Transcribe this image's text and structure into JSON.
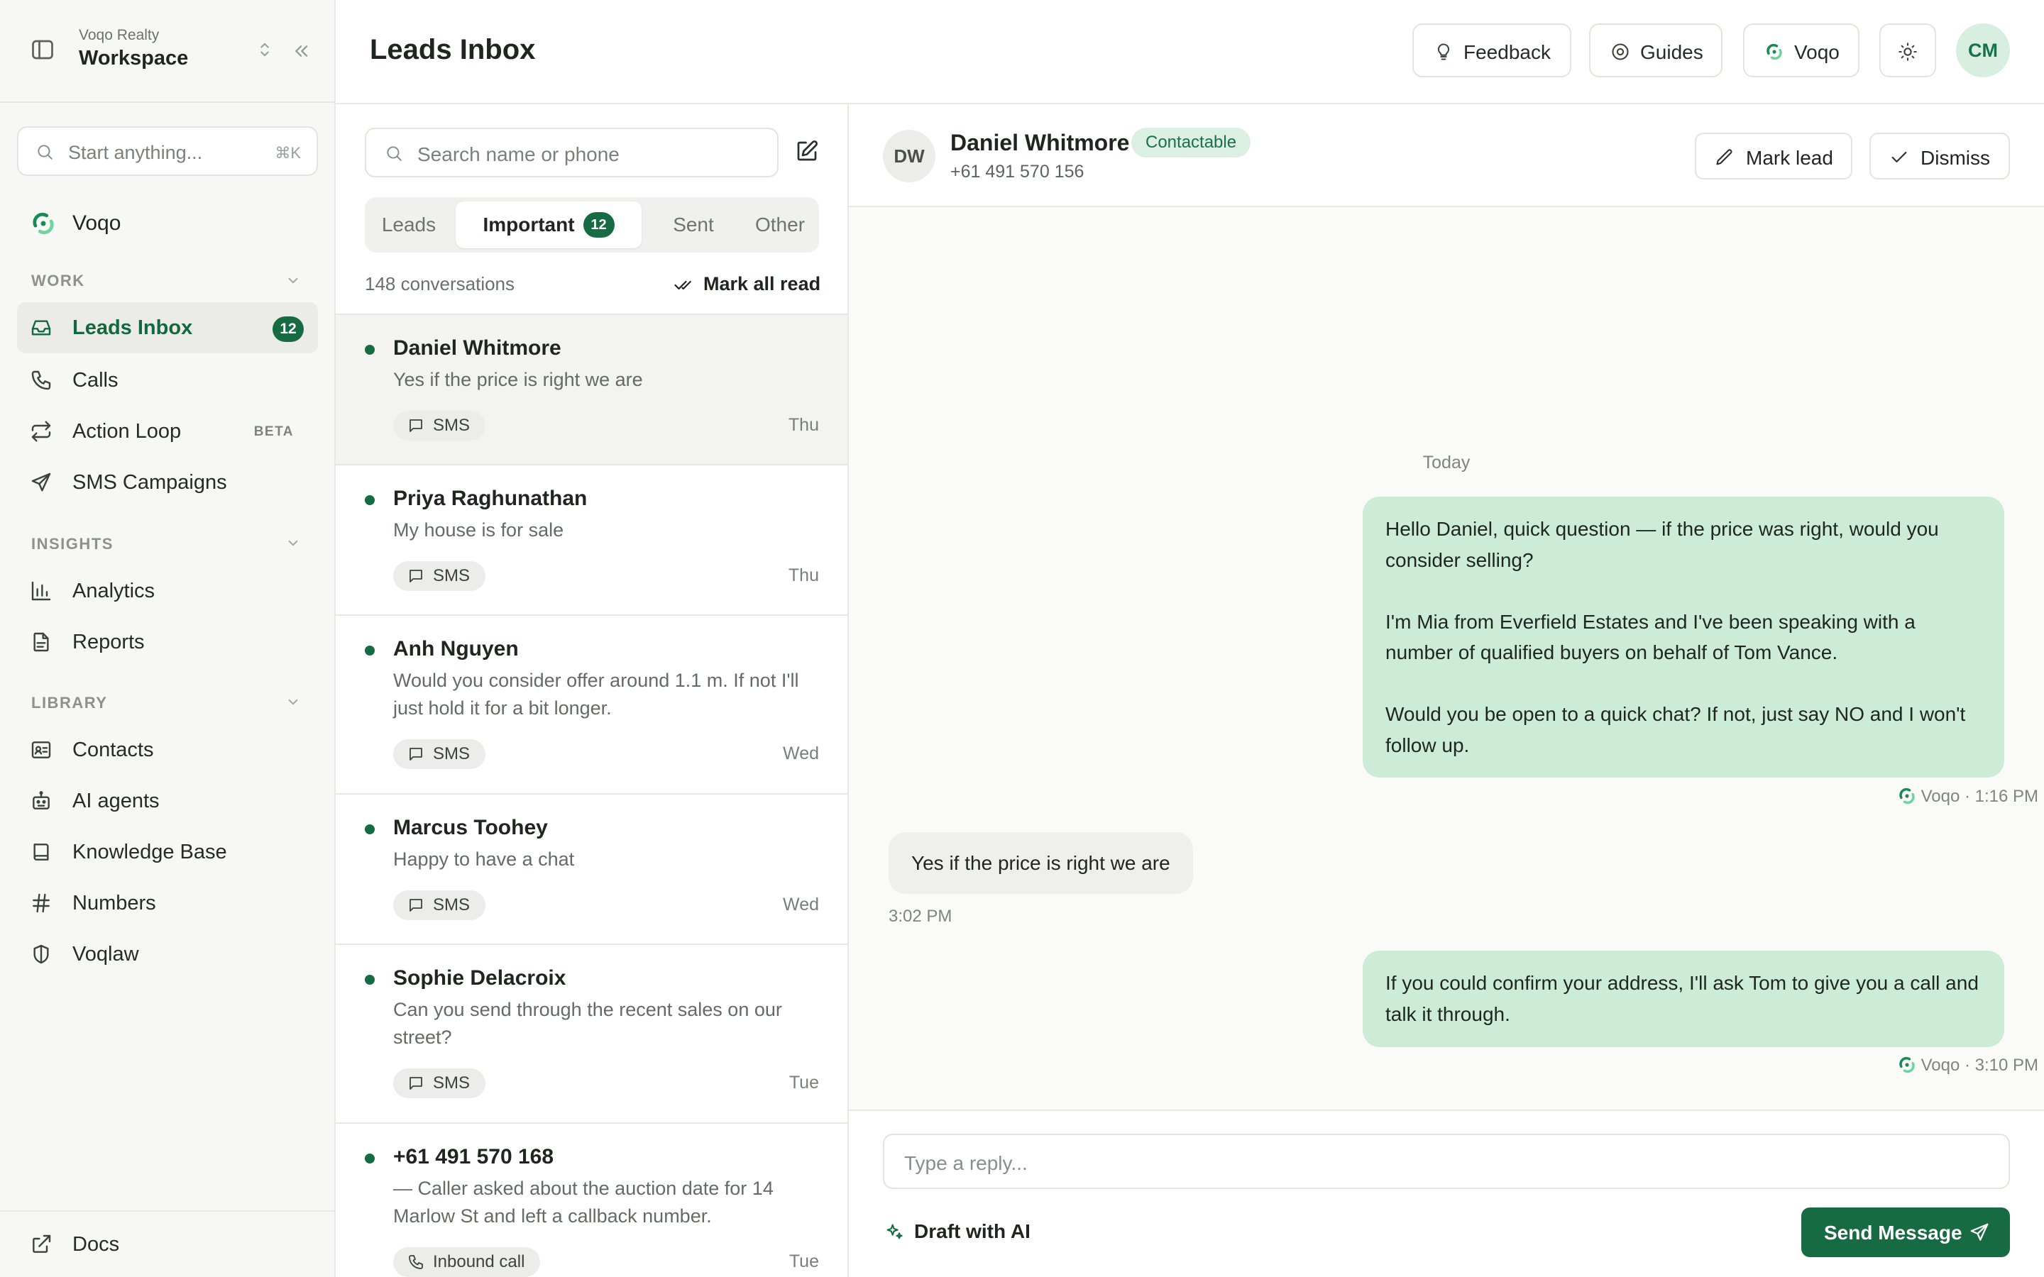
{
  "workspace": {
    "org": "Voqo Realty",
    "name": "Workspace"
  },
  "sidebar": {
    "search_placeholder": "Start anything...",
    "search_shortcut": "⌘K",
    "brand_label": "Voqo",
    "sections": {
      "work": "WORK",
      "insights": "INSIGHTS",
      "library": "LIBRARY"
    },
    "items": {
      "leads_inbox": {
        "label": "Leads Inbox",
        "badge": "12",
        "icon": "inbox-icon"
      },
      "calls": {
        "label": "Calls",
        "icon": "phone-icon"
      },
      "action_loop": {
        "label": "Action Loop",
        "tag": "BETA",
        "icon": "repeat-icon"
      },
      "sms_campaigns": {
        "label": "SMS Campaigns",
        "icon": "send-icon"
      },
      "analytics": {
        "label": "Analytics",
        "icon": "bar-chart-icon"
      },
      "reports": {
        "label": "Reports",
        "icon": "file-text-icon"
      },
      "contacts": {
        "label": "Contacts",
        "icon": "contact-card-icon"
      },
      "ai_agents": {
        "label": "AI agents",
        "icon": "robot-icon"
      },
      "knowledge_base": {
        "label": "Knowledge Base",
        "icon": "book-icon"
      },
      "numbers": {
        "label": "Numbers",
        "icon": "hash-icon"
      },
      "voqlaw": {
        "label": "Voqlaw",
        "icon": "shield-icon"
      }
    },
    "footer": {
      "docs": {
        "label": "Docs",
        "icon": "external-link-icon"
      }
    }
  },
  "header": {
    "title": "Leads Inbox",
    "feedback": "Feedback",
    "guides": "Guides",
    "voqo": "Voqo",
    "user_initials": "CM"
  },
  "list": {
    "search_placeholder": "Search name or phone",
    "tabs": {
      "leads": "Leads",
      "important": "Important",
      "important_count": "12",
      "sent": "Sent",
      "other": "Other"
    },
    "count_text": "148 conversations",
    "mark_all_read": "Mark all read",
    "conversations": [
      {
        "name": "Daniel Whitmore",
        "preview": "Yes if the price is right we are",
        "channel": "SMS",
        "time": "Thu"
      },
      {
        "name": "Priya Raghunathan",
        "preview": "My house is for sale",
        "channel": "SMS",
        "time": "Thu"
      },
      {
        "name": "Anh Nguyen",
        "preview": "Would you consider offer around 1.1 m. If not I'll just hold it for a bit longer.",
        "channel": "SMS",
        "time": "Wed"
      },
      {
        "name": "Marcus Toohey",
        "preview": "Happy to have a chat",
        "channel": "SMS",
        "time": "Wed"
      },
      {
        "name": "Sophie Delacroix",
        "preview": "Can you send through the recent sales on our street?",
        "channel": "SMS",
        "time": "Tue"
      },
      {
        "name": "+61 491 570 168",
        "preview": "— Caller asked about the auction date for 14 Marlow St and left a callback number.",
        "channel": "Inbound call",
        "time": "Tue"
      }
    ]
  },
  "chat": {
    "contact_initials": "DW",
    "contact_name": "Daniel Whitmore",
    "status": "Contactable",
    "phone": "+61 491 570 156",
    "mark_lead": "Mark lead",
    "dismiss": "Dismiss",
    "day": "Today",
    "messages": [
      {
        "dir": "out",
        "text": "Hello Daniel, quick question — if the price was right, would you consider selling?\n\nI'm Mia from Everfield Estates and I've been speaking with a number of qualified buyers on behalf of Tom Vance.\n\nWould you be open to a quick chat? If not, just say NO and I won't follow up.",
        "meta": "Voqo · 1:16 PM"
      },
      {
        "dir": "in",
        "text": "Yes if the price is right we are",
        "meta": "3:02 PM"
      },
      {
        "dir": "out",
        "text": "If you could confirm your address, I'll ask Tom to give you a call and talk it through.",
        "meta": "Voqo · 3:10 PM"
      }
    ],
    "reply_placeholder": "Type a reply...",
    "draft_ai": "Draft with AI",
    "send": "Send Message"
  },
  "colors": {
    "brand_green": "#176b43",
    "outgoing_bubble": "#cdecd8",
    "incoming_bubble": "#efefed",
    "status_badge_bg": "#dcefe3"
  }
}
